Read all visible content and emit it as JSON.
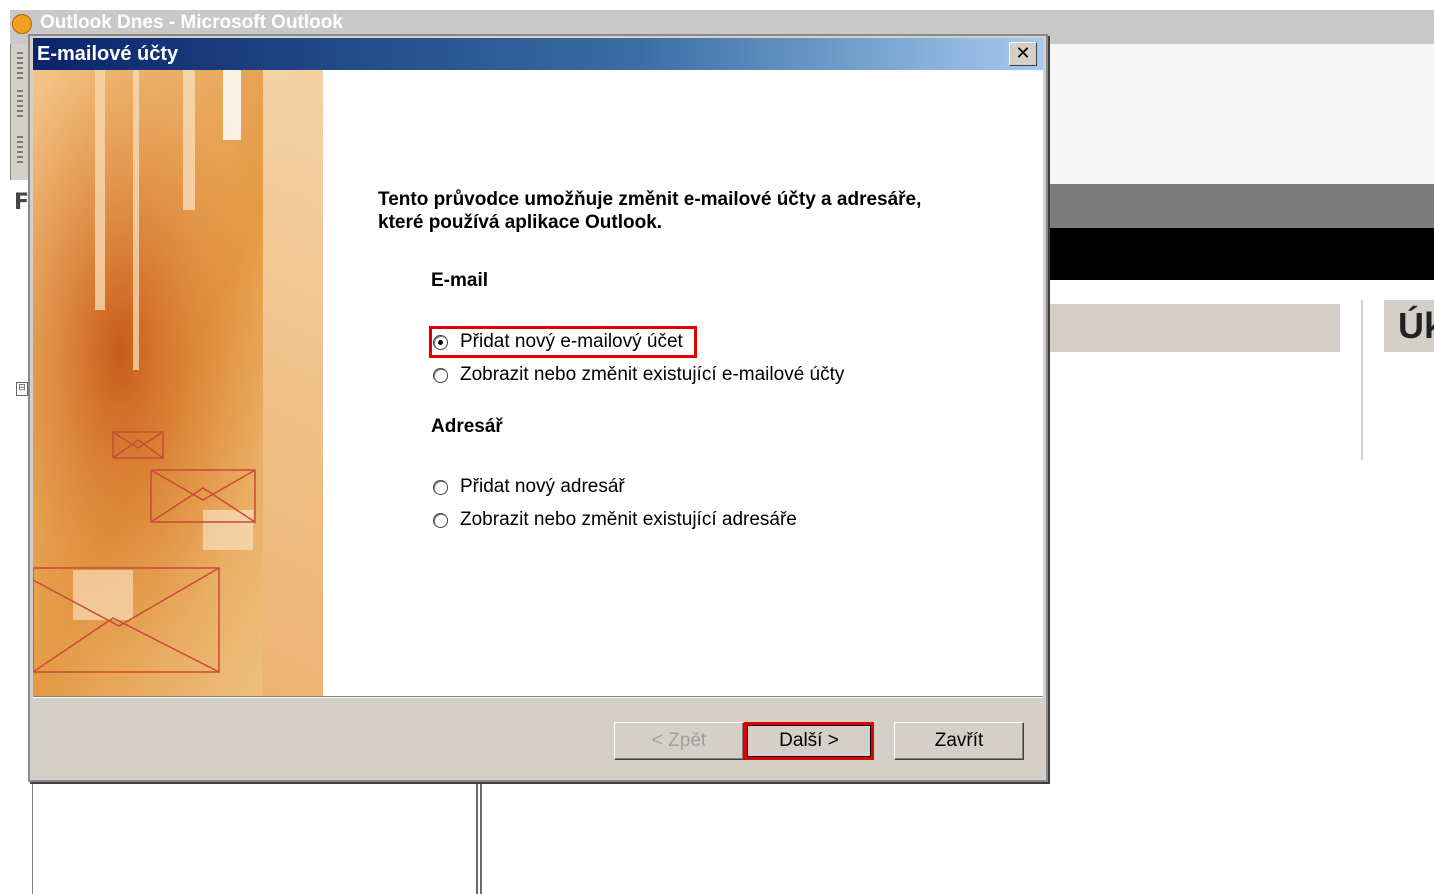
{
  "background": {
    "window_title": "Outlook Dnes - Microsoft Outlook",
    "left_letter": "F",
    "expander": "⊟",
    "tasks_label": "Úk"
  },
  "dialog": {
    "title": "E-mailové účty",
    "close_glyph": "✕",
    "intro": "Tento průvodce umožňuje změnit e-mailové účty a adresáře, které používá aplikace Outlook.",
    "email_section": {
      "title": "E-mail",
      "options": [
        {
          "label": "Přidat nový e-mailový účet",
          "checked": true
        },
        {
          "label": "Zobrazit nebo změnit existující e-mailové účty",
          "checked": false
        }
      ]
    },
    "addressbook_section": {
      "title": "Adresář",
      "options": [
        {
          "label": "Přidat nový adresář",
          "checked": false
        },
        {
          "label": "Zobrazit nebo změnit existující adresáře",
          "checked": false
        }
      ]
    },
    "buttons": {
      "back": "< Zpět",
      "next": "Další >",
      "close": "Zavřít"
    }
  },
  "colors": {
    "highlight": "#e00000",
    "banner_orange": "#e89a3c",
    "title_blue": "#0a246a"
  }
}
